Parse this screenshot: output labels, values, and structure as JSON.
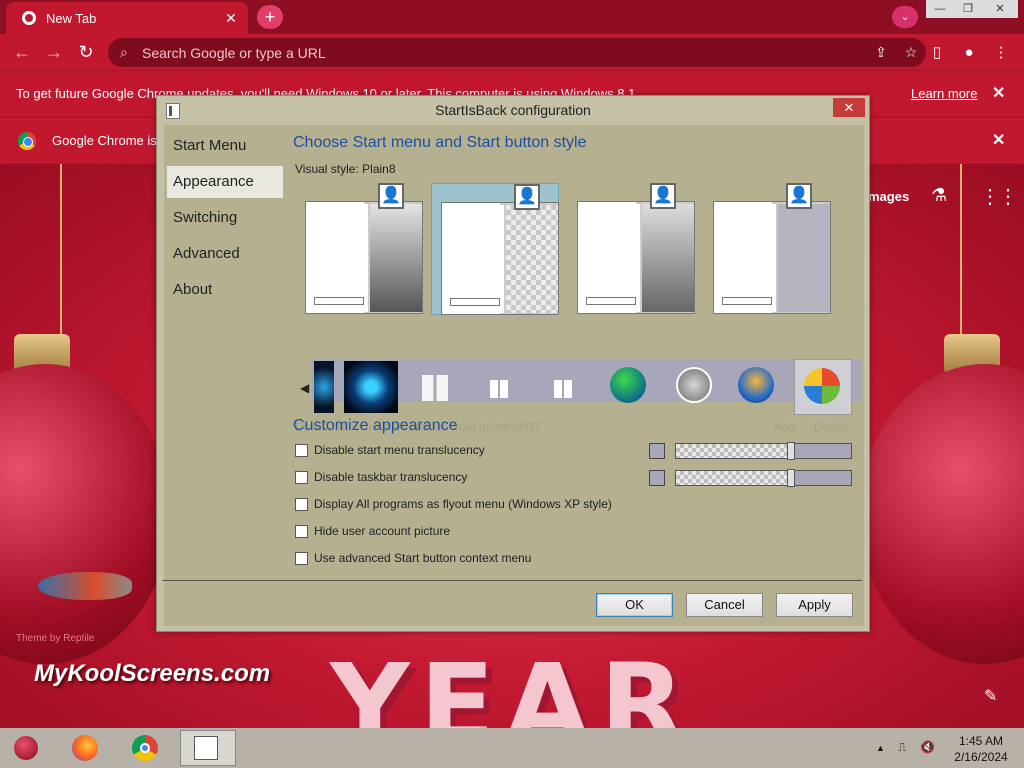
{
  "browser": {
    "tab_title": "New Tab",
    "tab_close": "✕",
    "new_tab": "+",
    "tab_search": "⌄",
    "minimize": "—",
    "restore": "❐",
    "close": "✕",
    "omnibox_placeholder": "Search Google or type a URL",
    "back": "←",
    "forward": "→",
    "reload": "↻",
    "icons": {
      "search": "⌕",
      "share": "⇪",
      "bookmark": "☆",
      "sidepanel": "▯",
      "profile": "●",
      "menu": "⋮"
    }
  },
  "infobars": [
    {
      "text": "To get future Google Chrome updates, you'll need Windows 10 or later. This computer is using Windows 8.1.",
      "link": "Learn more",
      "close": "✕"
    },
    {
      "text": "Google Chrome is",
      "close": "✕"
    }
  ],
  "newtab_page": {
    "images_link": "mages",
    "labs_icon": "⚗",
    "apps_icon": "⋮⋮⋮",
    "edit_icon": "✎"
  },
  "dialog": {
    "title": "StartIsBack configuration",
    "close": "✕",
    "nav": [
      {
        "label": "Start Menu",
        "active": false
      },
      {
        "label": "Appearance",
        "active": true
      },
      {
        "label": "Switching",
        "active": false
      },
      {
        "label": "Advanced",
        "active": false
      },
      {
        "label": "About",
        "active": false
      }
    ],
    "heading_style": "Choose Start menu and Start button style",
    "visual_style_label": "Visual style:",
    "visual_style_value": "Plain8",
    "styles": [
      {
        "sidebar": "gradient",
        "selected": false
      },
      {
        "sidebar": "checker",
        "selected": true
      },
      {
        "sidebar": "gradient",
        "selected": false
      },
      {
        "sidebar": "grey",
        "selected": false
      }
    ],
    "download_link": "Download more start buttons from deviantART",
    "add_link": "Add...",
    "delete_link": "Delete",
    "heading_customize": "Customize appearance",
    "options": [
      {
        "label": "Disable start menu translucency",
        "checked": false,
        "slider": 0.65
      },
      {
        "label": "Disable taskbar translucency",
        "checked": false,
        "slider": 0.65
      },
      {
        "label": "Display All programs as flyout menu (Windows XP style)",
        "checked": false
      },
      {
        "label": "Hide user account picture",
        "checked": false
      },
      {
        "label": "Use advanced Start button context menu",
        "checked": false
      }
    ],
    "buttons": {
      "ok": "OK",
      "cancel": "Cancel",
      "apply": "Apply"
    }
  },
  "desktop": {
    "watermark": "MyKoolScreens.com",
    "year_text": "YEAR",
    "fish_caption": "Theme by Reptile"
  },
  "taskbar": {
    "clock_time": "1:45 AM",
    "clock_date": "2/16/2024",
    "tray": {
      "expand": "▲",
      "network": "⎍",
      "volume": "🔇"
    }
  },
  "colors": {
    "chrome_red": "#c2182f",
    "dialog_bg": "#b5b08f",
    "heading_blue": "#1e50a0"
  }
}
